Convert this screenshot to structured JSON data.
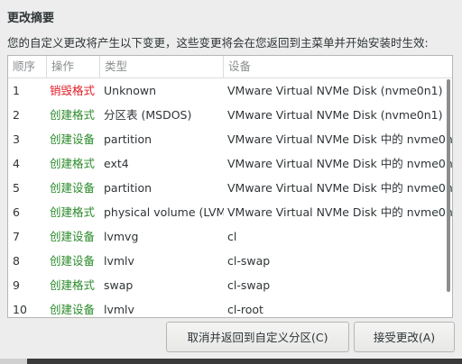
{
  "dialog": {
    "title": "更改摘要",
    "subtitle": "您的自定义更改将产生以下变更，这些变更将会在您返回到主菜单并开始安装时生效:"
  },
  "table": {
    "columns": [
      "顺序",
      "操作",
      "类型",
      "设备"
    ],
    "rows": [
      {
        "order": "1",
        "action": "销毁格式",
        "action_kind": "destroy",
        "type": "Unknown",
        "device": "VMware Virtual NVMe Disk (nvme0n1)"
      },
      {
        "order": "2",
        "action": "创建格式",
        "action_kind": "create",
        "type": "分区表 (MSDOS)",
        "device": "VMware Virtual NVMe Disk (nvme0n1)"
      },
      {
        "order": "3",
        "action": "创建设备",
        "action_kind": "create",
        "type": "partition",
        "device": "VMware Virtual NVMe Disk 中的 nvme0n1p"
      },
      {
        "order": "4",
        "action": "创建格式",
        "action_kind": "create",
        "type": "ext4",
        "device": "VMware Virtual NVMe Disk 中的 nvme0n1p"
      },
      {
        "order": "5",
        "action": "创建设备",
        "action_kind": "create",
        "type": "partition",
        "device": "VMware Virtual NVMe Disk 中的 nvme0n1p"
      },
      {
        "order": "6",
        "action": "创建格式",
        "action_kind": "create",
        "type": "physical volume (LVM)",
        "device": "VMware Virtual NVMe Disk 中的 nvme0n1p"
      },
      {
        "order": "7",
        "action": "创建设备",
        "action_kind": "create",
        "type": "lvmvg",
        "device": "cl"
      },
      {
        "order": "8",
        "action": "创建设备",
        "action_kind": "create",
        "type": "lvmlv",
        "device": "cl-swap"
      },
      {
        "order": "9",
        "action": "创建格式",
        "action_kind": "create",
        "type": "swap",
        "device": "cl-swap"
      },
      {
        "order": "10",
        "action": "创建设备",
        "action_kind": "create",
        "type": "lvmlv",
        "device": "cl-root"
      }
    ]
  },
  "buttons": {
    "cancel_label": "取消并返回到自定义分区(C)",
    "accept_label": "接受更改(A)"
  },
  "colors": {
    "destroy": "#e01b24",
    "create": "#2a8a2a"
  }
}
